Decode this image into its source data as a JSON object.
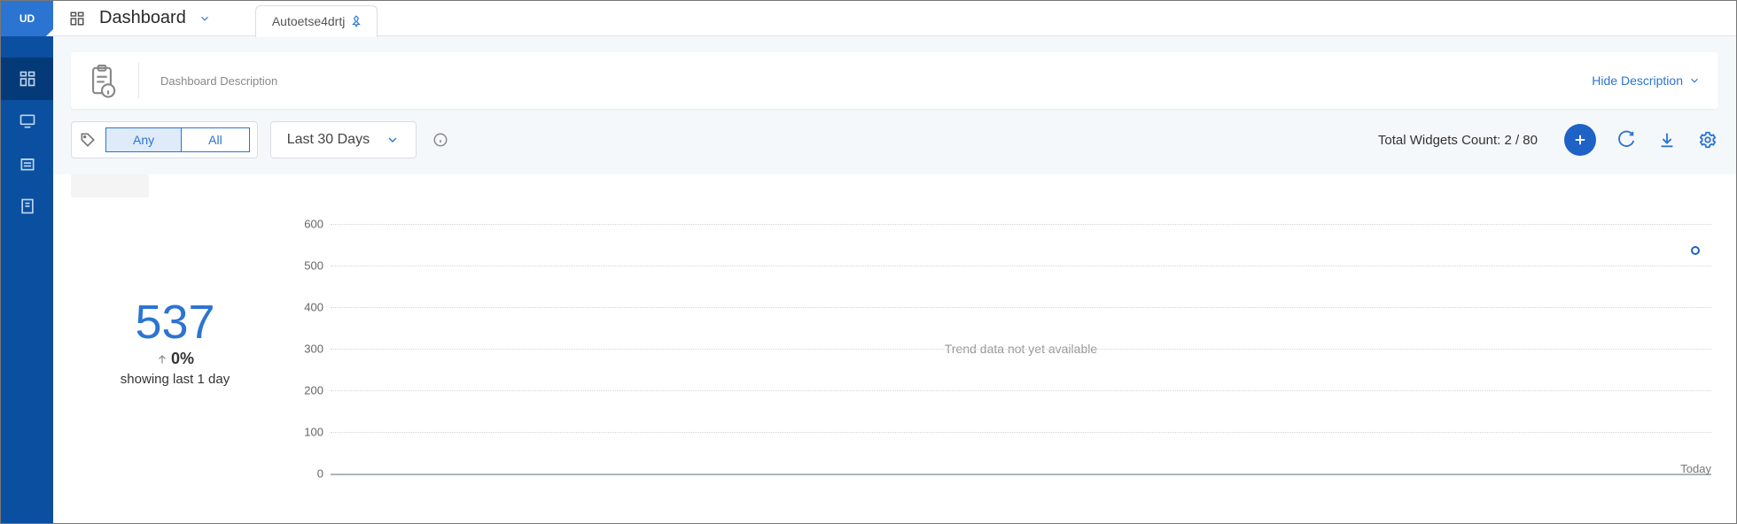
{
  "logo_text": "UD",
  "header": {
    "title": "Dashboard",
    "tab_label": "Autoetse4drtj"
  },
  "description": {
    "label": "Dashboard Description",
    "hide_label": "Hide Description"
  },
  "filters": {
    "seg_any": "Any",
    "seg_all": "All",
    "range_label": "Last 30 Days"
  },
  "toolbar": {
    "widgets_count_label": "Total Widgets Count: 2 / 80"
  },
  "kpi": {
    "value": "537",
    "delta": "0%",
    "subtext": "showing last 1 day"
  },
  "chart_data": {
    "type": "line",
    "ylim": [
      0,
      600
    ],
    "yticks": [
      0,
      100,
      200,
      300,
      400,
      500,
      600
    ],
    "x_labels": [
      "Today"
    ],
    "series": [
      {
        "name": "",
        "points": [
          {
            "x_label": "Today",
            "y": 537
          }
        ]
      }
    ],
    "message": "Trend data not yet available"
  }
}
